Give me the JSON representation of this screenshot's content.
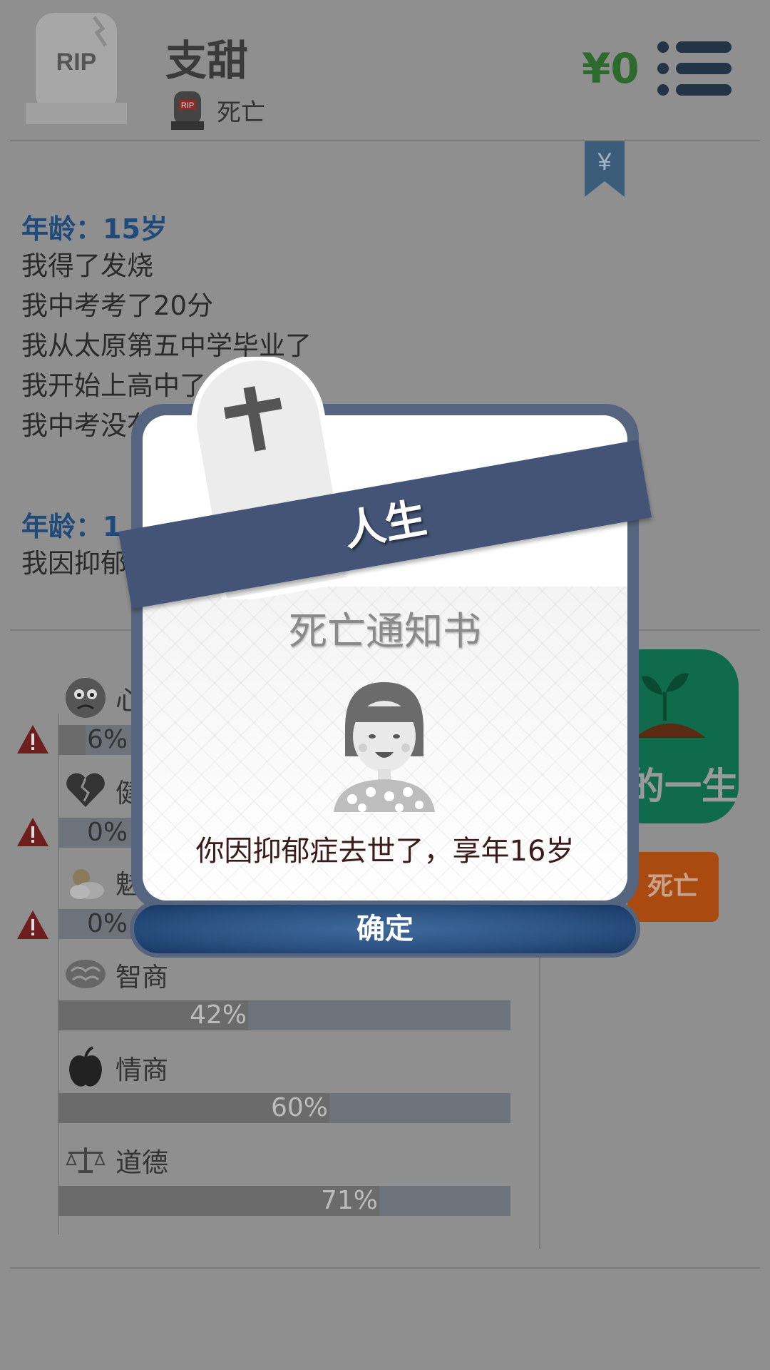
{
  "header": {
    "tombstone_text": "RIP",
    "name": "支甜",
    "status": "死亡",
    "money": "¥0",
    "bookmark_symbol": "¥"
  },
  "log": {
    "block1": {
      "age": "年龄：15岁",
      "events": [
        "我得了发烧",
        "我中考考了20分",
        "我从太原第五中学毕业了",
        "我开始上高中了",
        "我中考没有"
      ]
    },
    "block2": {
      "age": "年龄：1",
      "events": [
        "我因抑郁"
      ]
    }
  },
  "stats": [
    {
      "label": "心",
      "percent": "6%",
      "value": 0.06,
      "warning": true,
      "icon": "sad-face-icon"
    },
    {
      "label": "健",
      "percent": "0%",
      "value": 0.0,
      "warning": true,
      "icon": "broken-heart-icon"
    },
    {
      "label": "魅",
      "percent": "0%",
      "value": 0.0,
      "warning": true,
      "icon": "weather-icon"
    },
    {
      "label": "智商",
      "percent": "42%",
      "value": 0.42,
      "warning": false,
      "icon": "brain-icon"
    },
    {
      "label": "情商",
      "percent": "60%",
      "value": 0.6,
      "warning": false,
      "icon": "apple-icon"
    },
    {
      "label": "道德",
      "percent": "71%",
      "value": 0.71,
      "warning": false,
      "icon": "scales-icon"
    }
  ],
  "side": {
    "green_label": "的一生",
    "orange_label": "死亡"
  },
  "modal": {
    "ribbon_title": "人生",
    "notice_title": "死亡通知书",
    "message": "你因抑郁症去世了，享年16岁",
    "confirm_label": "确定"
  },
  "colors": {
    "ribbon": "#435476",
    "money": "#2d6a2d",
    "age_heading": "#1f4a7a",
    "green_button": "#0f6b4b",
    "orange_button": "#a94a11"
  }
}
